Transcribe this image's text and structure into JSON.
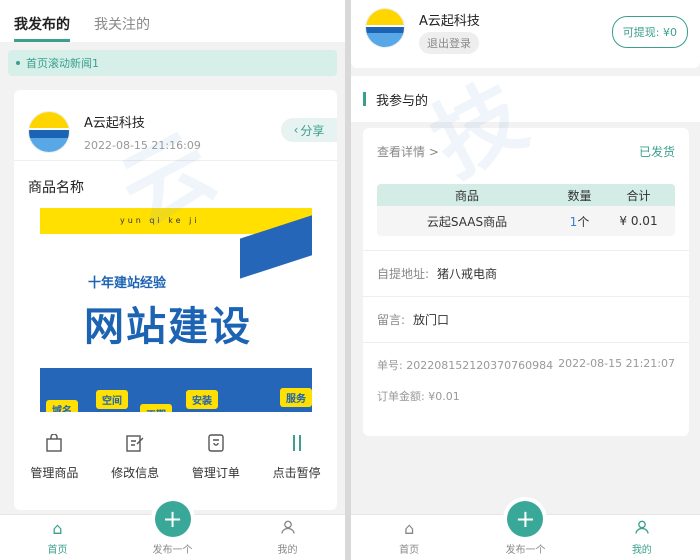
{
  "left": {
    "tabs": [
      "我发布的",
      "我关注的"
    ],
    "ticker": "首页滚动新闻1",
    "store": {
      "name": "A云起科技",
      "time": "2022-08-15 21:16:09",
      "share": "分享"
    },
    "goods_title": "商品名称",
    "banner": {
      "head": "十年建站经验",
      "main": "网站建设",
      "en": "yun qi ke ji",
      "tags": [
        "空间",
        "安装",
        "服务",
        "域名",
        "工期"
      ]
    },
    "ops": [
      {
        "label": "管理商品",
        "icon": "bag-icon"
      },
      {
        "label": "修改信息",
        "icon": "edit-icon"
      },
      {
        "label": "管理订单",
        "icon": "order-icon"
      },
      {
        "label": "点击暂停",
        "icon": "pause-icon"
      }
    ],
    "nav": [
      {
        "label": "首页",
        "icon": "home-icon",
        "active": true
      },
      {
        "label": "发布一个",
        "icon": "plus-icon",
        "active": false
      },
      {
        "label": "我的",
        "icon": "user-icon",
        "active": false
      }
    ]
  },
  "right": {
    "profile": {
      "name": "A云起科技",
      "logout": "退出登录",
      "withdraw": "可提现: ¥0"
    },
    "section_title": "我参与的",
    "order": {
      "detail_link": "查看详情 >",
      "status": "已发货",
      "headers": [
        "商品",
        "数量",
        "合计"
      ],
      "rows": [
        {
          "name": "云起SAAS商品",
          "qty_num": "1",
          "qty_unit": "个",
          "total": "¥ 0.01"
        }
      ],
      "address_label": "自提地址:",
      "address": "猪八戒电商",
      "remark_label": "留言:",
      "remark": "放门口",
      "order_no": "单号: 20220815212037076098​4",
      "order_time": "2022-08-15 21:21:07",
      "amount": "订单金额: ¥0.01"
    },
    "nav": [
      {
        "label": "首页",
        "icon": "home-icon",
        "active": false
      },
      {
        "label": "发布一个",
        "icon": "plus-icon",
        "active": false
      },
      {
        "label": "我的",
        "icon": "user-icon",
        "active": true
      }
    ]
  },
  "colors": {
    "accent": "#3a9f8e",
    "accent_light": "#d6efe9",
    "brand_blue": "#1d63b4",
    "brand_yellow": "#ffe000"
  }
}
